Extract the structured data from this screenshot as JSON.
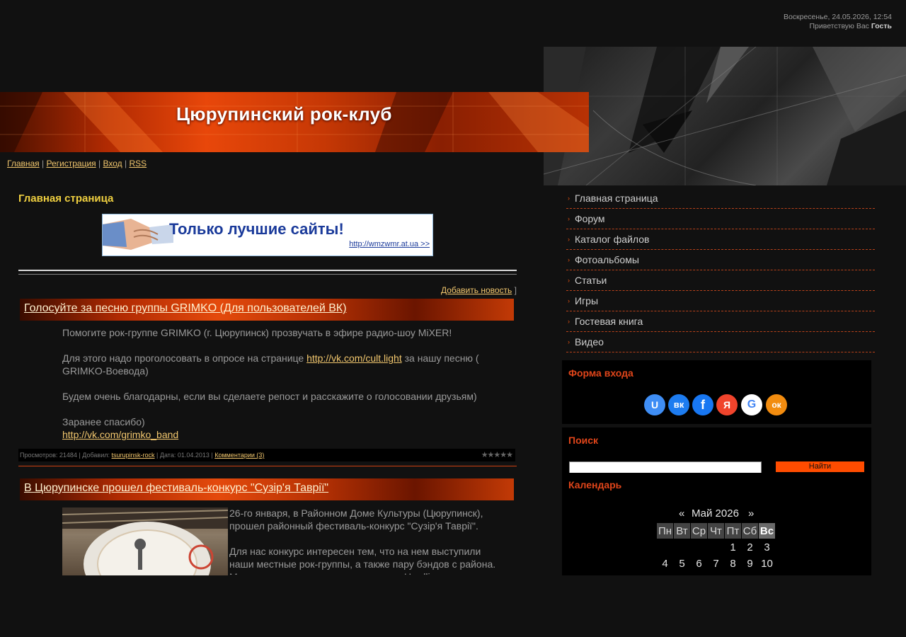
{
  "top": {
    "date": "Воскресенье, 24.05.2026, 12:54",
    "greeting": "Приветствую Вас",
    "user": "Гость"
  },
  "site": {
    "title": "Цюрупинский рок-клуб"
  },
  "topnav": {
    "home": "Главная",
    "register": "Регистрация",
    "login": "Вход",
    "rss": "RSS",
    "sep": "|"
  },
  "content": {
    "heading": "Главная страница",
    "ad": {
      "text": "Только лучшие сайты!",
      "url": "http://wmzwmr.at.ua >>"
    },
    "add_news": "Добавить новость",
    "add_news_bracket": "]"
  },
  "posts": [
    {
      "title": "Голосуйте за песню группы GRIMKO (Для пользователей ВК)",
      "p1": "Помогите рок-группе GRIMKO (г. Цюрупинск) прозвучать в эфире радио-шоу MiXER!",
      "p2_a": "Для этого надо проголосовать в опросе на странице",
      "p2_link": "http://vk.com/cult.light",
      "p2_b": "за нашу песню ( GRIMKO-Воевода)",
      "p3": "Будем очень благодарны, если вы сделаете репост и расскажите о голосовании друзьям)",
      "p4": "Заранее спасибо)",
      "p4_link": "http://vk.com/grimko_band",
      "meta": {
        "views_label": "Просмотров:",
        "views": "21484",
        "added_label": "Добавил:",
        "author": "tsurupinsk-rock",
        "date_label": "Дата:",
        "date": "01.04.2013",
        "comments": "Комментарии (3)",
        "rating": 0,
        "stars": "★★★★★"
      }
    },
    {
      "title": "В Цюрупинске прошел фестиваль-конкурс \"Сузір'я Таврії\"",
      "p1": "26-го января, в Районном Доме Культуры (Цюрупинск), прошел районный фестиваль-конкурс \"Сузір'я Таврії\".",
      "p2": "Для нас конкурс интересен тем, что на нем выступили наши местные рок-группы, а также пару бэндов с района. Местную сцену представляли группы Hardline"
    }
  ],
  "menu": [
    "Главная страница",
    "Форум",
    "Каталог файлов",
    "Фотоальбомы",
    "Статьи",
    "Игры",
    "Гостевая книга",
    "Видео"
  ],
  "login_block": {
    "title": "Форма входа",
    "socials": [
      {
        "name": "ucoz",
        "glyph": "U",
        "color": "#3f8ef5"
      },
      {
        "name": "vk",
        "glyph": "вк",
        "color": "#1d7cf0"
      },
      {
        "name": "facebook",
        "glyph": "f",
        "color": "#1877f2"
      },
      {
        "name": "yandex",
        "glyph": "Я",
        "color": "#f0442c"
      },
      {
        "name": "google",
        "glyph": "G",
        "color": "#ffffff"
      },
      {
        "name": "odnoklassniki",
        "glyph": "ок",
        "color": "#f28c0f"
      }
    ]
  },
  "search_block": {
    "title": "Поиск",
    "button": "Найти",
    "value": ""
  },
  "calendar": {
    "title": "Календарь",
    "prev": "«",
    "next": "»",
    "month": "Май 2026",
    "days": [
      "Пн",
      "Вт",
      "Ср",
      "Чт",
      "Пт",
      "Сб",
      "Вс"
    ],
    "rows": [
      [
        "",
        "",
        "",
        "",
        "1",
        "2",
        "3"
      ],
      [
        "4",
        "5",
        "6",
        "7",
        "8",
        "9",
        "10"
      ]
    ]
  }
}
